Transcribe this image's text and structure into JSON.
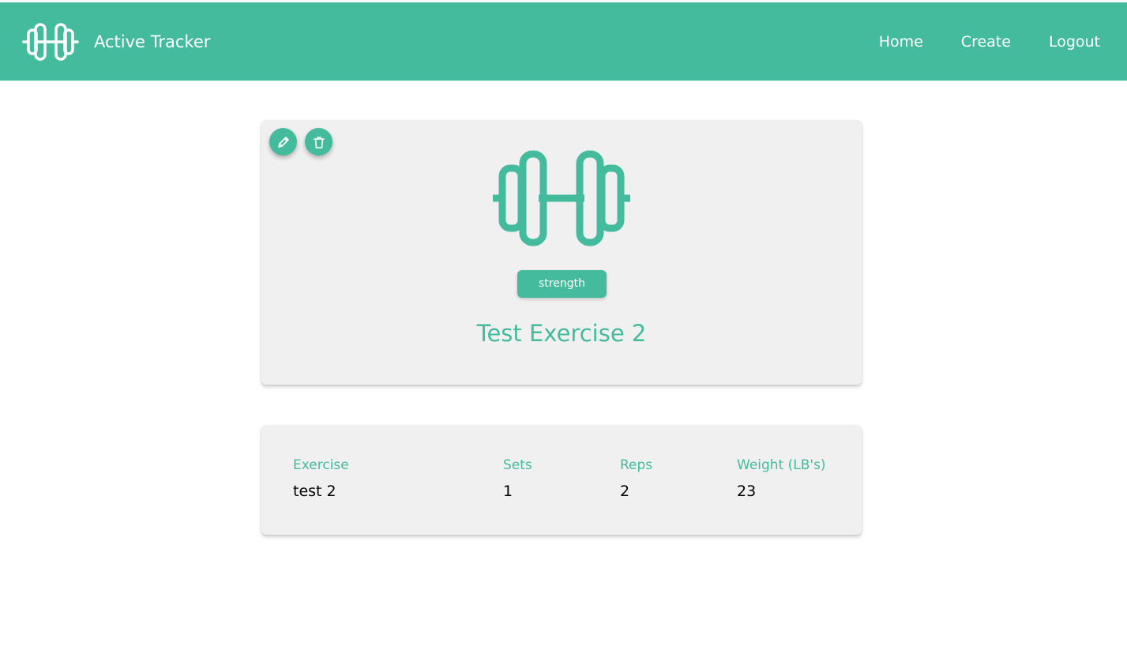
{
  "colors": {
    "accent": "#44bb9d",
    "card_background": "#f0f0f0",
    "text_dark": "#000000",
    "text_light": "#ffffff"
  },
  "header": {
    "app_name": "Active Tracker",
    "logo_icon": "dumbbell-icon",
    "nav": [
      {
        "label": "Home"
      },
      {
        "label": "Create"
      },
      {
        "label": "Logout"
      }
    ]
  },
  "exercise_card": {
    "edit_icon": "pencil-icon",
    "delete_icon": "trash-icon",
    "hero_icon": "dumbbell-icon",
    "category": "strength",
    "title": "Test Exercise 2"
  },
  "details": {
    "columns": [
      {
        "label": "Exercise",
        "value": "test 2"
      },
      {
        "label": "Sets",
        "value": "1"
      },
      {
        "label": "Reps",
        "value": "2"
      },
      {
        "label": "Weight (LB's)",
        "value": "23"
      }
    ]
  }
}
